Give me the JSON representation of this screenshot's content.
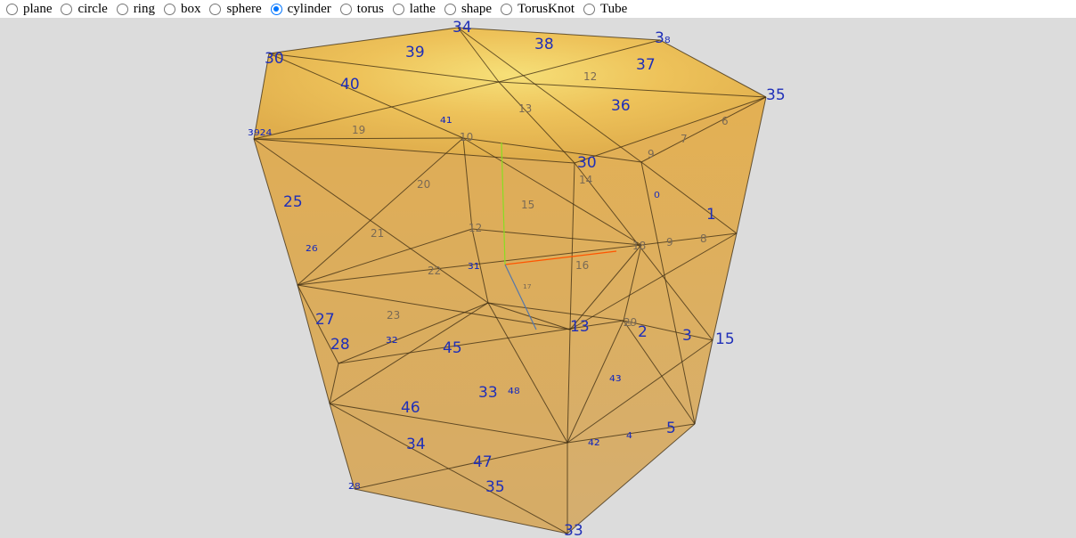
{
  "shape_selector": {
    "options": [
      {
        "label": "plane",
        "selected": false
      },
      {
        "label": "circle",
        "selected": false
      },
      {
        "label": "ring",
        "selected": false
      },
      {
        "label": "box",
        "selected": false
      },
      {
        "label": "sphere",
        "selected": false
      },
      {
        "label": "cylinder",
        "selected": true
      },
      {
        "label": "torus",
        "selected": false
      },
      {
        "label": "lathe",
        "selected": false
      },
      {
        "label": "shape",
        "selected": false
      },
      {
        "label": "TorusKnot",
        "selected": false
      },
      {
        "label": "Tube",
        "selected": false
      }
    ]
  },
  "viewport": {
    "background": "#dcdcdc",
    "mesh_fill": "#e8b24a",
    "edge_color": "#3a2a10",
    "vertex_label_color": "#1f2fb8",
    "face_label_color": "#7a6a55",
    "axes": {
      "x_color": "#ff5500",
      "y_color": "#88dd22",
      "z_color": "#5577aa"
    },
    "vertex_labels": [
      "34",
      "38",
      "3₈",
      "30",
      "37",
      "40",
      "39",
      "₄₁",
      "12",
      "36",
      "35",
      "₃₉₂₄",
      "19",
      "13",
      "6",
      "7",
      "10",
      "9",
      "₀",
      "14",
      "1",
      "30",
      "20",
      "25",
      "15",
      "21",
      "18",
      "9",
      "8",
      "12",
      "₂₆",
      "₃₁",
      "16",
      "22",
      "27",
      "23",
      "₁₇",
      "13",
      "2",
      "29",
      "3",
      "15",
      "₃₂",
      "45",
      "28",
      "33",
      "₄₈",
      "₄₃",
      "₂₉",
      "46",
      "₄",
      "5",
      "₂₈",
      "₄₂",
      "34",
      "47",
      "35",
      "33"
    ]
  }
}
